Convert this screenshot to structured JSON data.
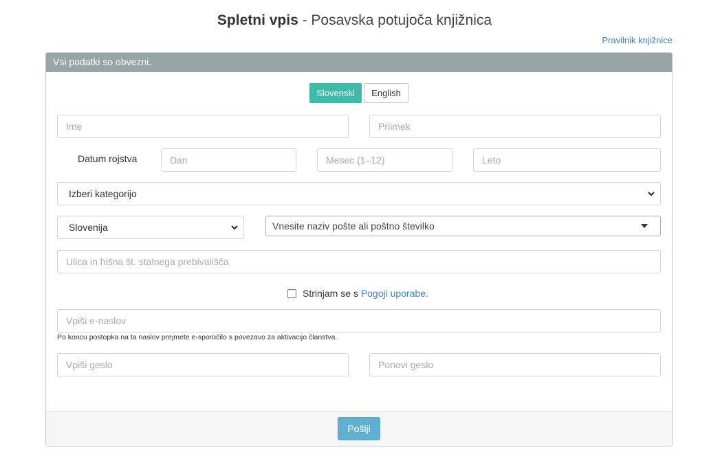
{
  "header": {
    "title_bold": "Spletni vpis",
    "title_rest": " - Posavska potujoča knjižnica",
    "rules_link": "Pravilnik knjižnice"
  },
  "panel": {
    "heading": "Vsi podatki so obvezni."
  },
  "language": {
    "options": [
      "Slovenski",
      "English"
    ],
    "selected": "Slovenski"
  },
  "form": {
    "first_name_placeholder": "Ime",
    "last_name_placeholder": "Priimek",
    "birth_label": "Datum rojstva",
    "day_placeholder": "Dan",
    "month_placeholder": "Mesec (1–12)",
    "year_placeholder": "Leto",
    "category_value": "Izberi kategorijo",
    "country_value": "Slovenija",
    "post_placeholder": "Vnesite naziv pošte ali poštno številko",
    "street_placeholder": "Ulica in hišna št. stalnega prebivališča",
    "terms_text": "Strinjam se s ",
    "terms_link": "Pogoji uporabe.",
    "email_placeholder": "Vpiši e-naslov",
    "email_hint": "Po koncu postopka na ta naslov prejmete e-sporočilo s povezavo za aktivacijo članstva.",
    "password_placeholder": "Vpiši geslo",
    "password_repeat_placeholder": "Ponovi geslo",
    "submit_label": "Pošlji"
  },
  "icons": {
    "select_arrow": "chevron-down-icon",
    "post_arrow": "caret-down-icon"
  },
  "colors": {
    "accent": "#3dbba9",
    "header_bar": "#97a6a4",
    "submit": "#5fb0cf",
    "link": "#3d7fc9"
  }
}
